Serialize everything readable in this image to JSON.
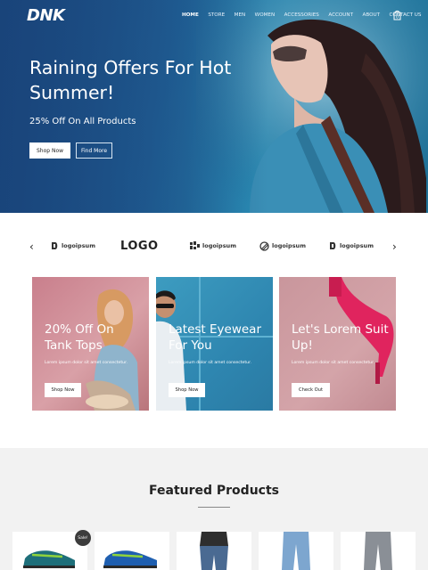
{
  "brand": {
    "logo": "DNK"
  },
  "nav": {
    "items": [
      "HOME",
      "STORE",
      "MEN",
      "WOMEN",
      "ACCESSORIES",
      "ACCOUNT",
      "ABOUT",
      "CONTACT US"
    ],
    "cart_count": "0"
  },
  "hero": {
    "title": "Raining Offers For Hot Summer!",
    "subtitle": "25% Off On All Products",
    "shop_button": "Shop Now",
    "find_button": "Find More"
  },
  "brands": {
    "logos": [
      "logoipsum",
      "LOGO",
      "logoipsum",
      "logoipsum",
      "logoipsum"
    ]
  },
  "promos": [
    {
      "title": "20% Off On Tank Tops",
      "text": "Lorem ipsum dolor sit amet consectetur.",
      "button": "Shop Now"
    },
    {
      "title": "Latest Eyewear For You",
      "text": "Lorem ipsum dolor sit amet consectetur.",
      "button": "Shop Now"
    },
    {
      "title": "Let's Lorem Suit Up!",
      "text": "Lorem ipsum dolor sit amet consectetur.",
      "button": "Check Out"
    }
  ],
  "featured": {
    "title": "Featured Products",
    "sale_badge": "Sale!"
  },
  "colors": {
    "hero": "#236aa0",
    "card1": "#d9a0a7",
    "card2": "#2e86b0",
    "card3": "#d4a4a9",
    "featured_bg": "#f2f2f2"
  }
}
